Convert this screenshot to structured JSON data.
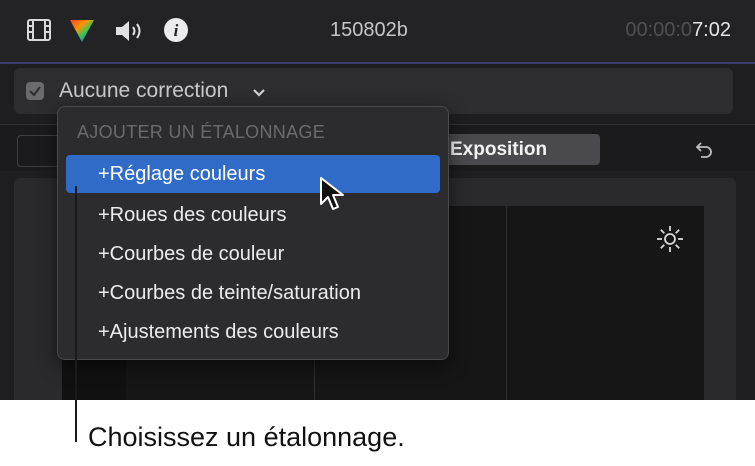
{
  "header": {
    "icons": [
      "film-strip-icon",
      "color-triangle-icon",
      "speaker-icon",
      "info-icon"
    ],
    "clip_name": "150802b",
    "timecode_dim": "00:00:0",
    "timecode_lit": "7:02"
  },
  "correction": {
    "checked": true,
    "label": "Aucune correction"
  },
  "tabs": {
    "active_label": "Exposition"
  },
  "menu": {
    "header": "AJOUTER UN ÉTALONNAGE",
    "items": [
      {
        "label": "+Réglage couleurs",
        "selected": true
      },
      {
        "label": "+Roues des couleurs",
        "selected": false
      },
      {
        "label": "+Courbes de couleur",
        "selected": false
      },
      {
        "label": "+Courbes de teinte/saturation",
        "selected": false
      },
      {
        "label": "+Ajustements des couleurs",
        "selected": false
      }
    ]
  },
  "caption": "Choisissez un étalonnage.",
  "colors": {
    "accent_selection": "#2f6bc7",
    "topbar_border": "#3a3d6e"
  }
}
